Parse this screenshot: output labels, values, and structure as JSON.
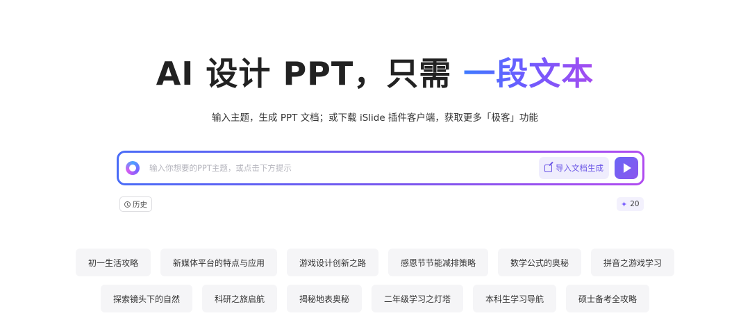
{
  "hero": {
    "title_main": "AI 设计 PPT，只需 ",
    "title_accent": "一段文本"
  },
  "subtitle": "输入主题，生成 PPT 文档；或下载 iSlide 插件客户端，获取更多「极客」功能",
  "prompt": {
    "placeholder": "输入你想要的PPT主题，或点击下方提示",
    "value": "",
    "import_label": "导入文档生成"
  },
  "history_label": "历史",
  "credits": "20",
  "colors": {
    "accent_blue": "#3f7bff",
    "accent_purple": "#a54cf0",
    "send_button": "#7b5cf0"
  },
  "suggestions_row1": [
    "初一生活攻略",
    "新媒体平台的特点与应用",
    "游戏设计创新之路",
    "感恩节节能减排策略",
    "数学公式的奥秘",
    "拼音之游戏学习"
  ],
  "suggestions_row2": [
    "探索镜头下的自然",
    "科研之旅启航",
    "揭秘地表奥秘",
    "二年级学习之灯塔",
    "本科生学习导航",
    "硕士备考全攻略"
  ]
}
